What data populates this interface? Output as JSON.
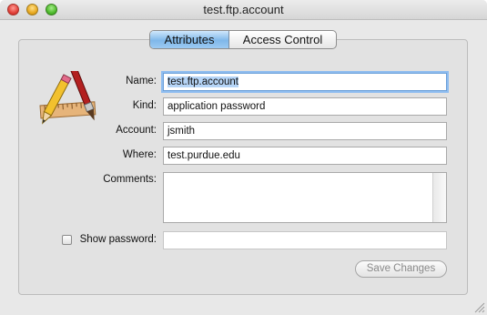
{
  "window": {
    "title": "test.ftp.account"
  },
  "tabs": [
    {
      "label": "Attributes",
      "active": true
    },
    {
      "label": "Access Control",
      "active": false
    }
  ],
  "icons": {
    "item_icon": "ruler-pencil-brush-icon",
    "close": "close-icon",
    "minimize": "minimize-icon",
    "zoom": "zoom-icon",
    "resize": "resize-grip-icon"
  },
  "form": {
    "name_label": "Name:",
    "name_value": "test.ftp.account",
    "kind_label": "Kind:",
    "kind_value": "application password",
    "account_label": "Account:",
    "account_value": "jsmith",
    "where_label": "Where:",
    "where_value": "test.purdue.edu",
    "comments_label": "Comments:",
    "comments_value": "",
    "show_password_label": "Show password:",
    "show_password_checked": false,
    "password_value": ""
  },
  "buttons": {
    "save_label": "Save Changes",
    "save_enabled": false
  },
  "colors": {
    "active_tab": "#7fb8ea",
    "focus_ring": "#8fbdf0",
    "close": "#e2413a",
    "minimize": "#e8a920",
    "zoom": "#4fbb2d"
  }
}
